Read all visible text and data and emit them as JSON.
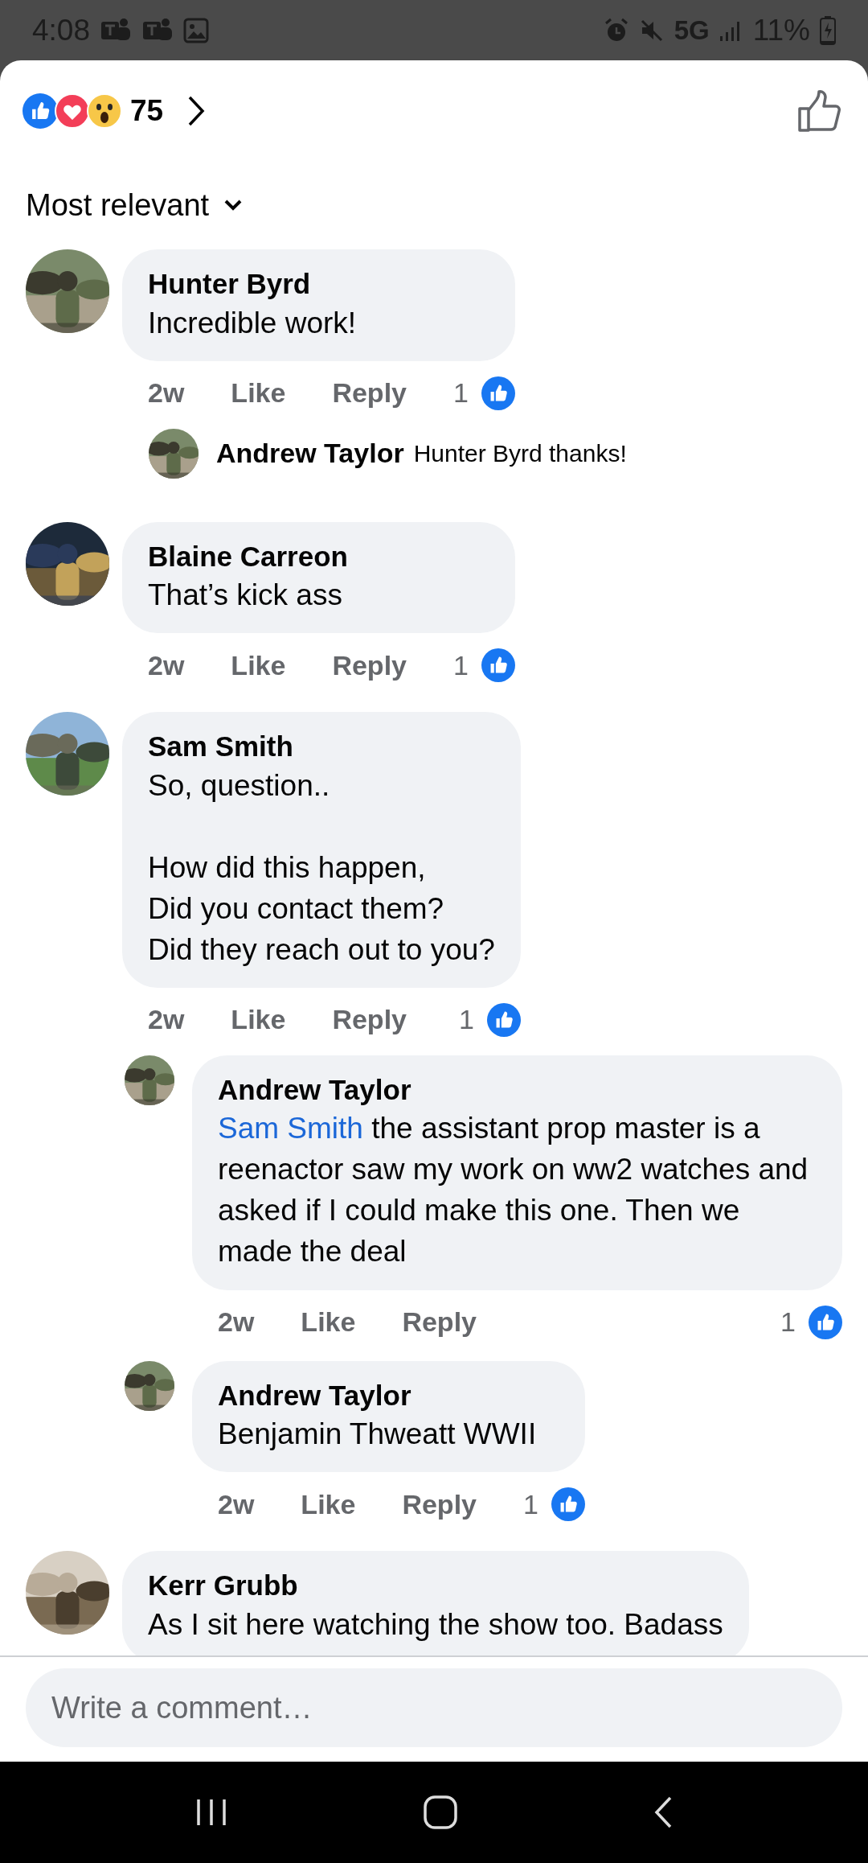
{
  "status_bar": {
    "time": "4:08",
    "network": "5G",
    "battery": "11%"
  },
  "reactions": {
    "count": "75"
  },
  "sort": {
    "label": "Most relevant"
  },
  "comments": [
    {
      "kind": "full",
      "author": "Hunter Byrd",
      "text": "Incredible work!",
      "time": "2w",
      "like": "Like",
      "reply": "Reply",
      "likes": "1",
      "replies": [
        {
          "kind": "compact",
          "author": "Andrew Taylor",
          "text": "Hunter Byrd thanks!"
        }
      ]
    },
    {
      "kind": "full",
      "author": "Blaine Carreon",
      "text": "That’s kick ass",
      "time": "2w",
      "like": "Like",
      "reply": "Reply",
      "likes": "1"
    },
    {
      "kind": "full",
      "author": "Sam Smith",
      "text": "So, question..\n\nHow did this happen,\nDid you contact them?\nDid they reach out to you?",
      "time": "2w",
      "like": "Like",
      "reply": "Reply",
      "likes": "1",
      "replies": [
        {
          "kind": "full",
          "author": "Andrew Taylor",
          "mention": "Sam Smith",
          "text": "the assistant prop master is a reenactor saw my work on ww2 watches and asked if I could make this one. Then we made the deal",
          "time": "2w",
          "like": "Like",
          "reply": "Reply",
          "likes": "1"
        },
        {
          "kind": "full",
          "author": "Andrew Taylor",
          "text": "Benjamin Thweatt WWII",
          "time": "2w",
          "like": "Like",
          "reply": "Reply",
          "likes": "1"
        }
      ]
    },
    {
      "kind": "full",
      "author": "Kerr Grubb",
      "text": "As I sit here watching the show too. Badass"
    }
  ],
  "composer": {
    "placeholder": "Write a comment…"
  }
}
